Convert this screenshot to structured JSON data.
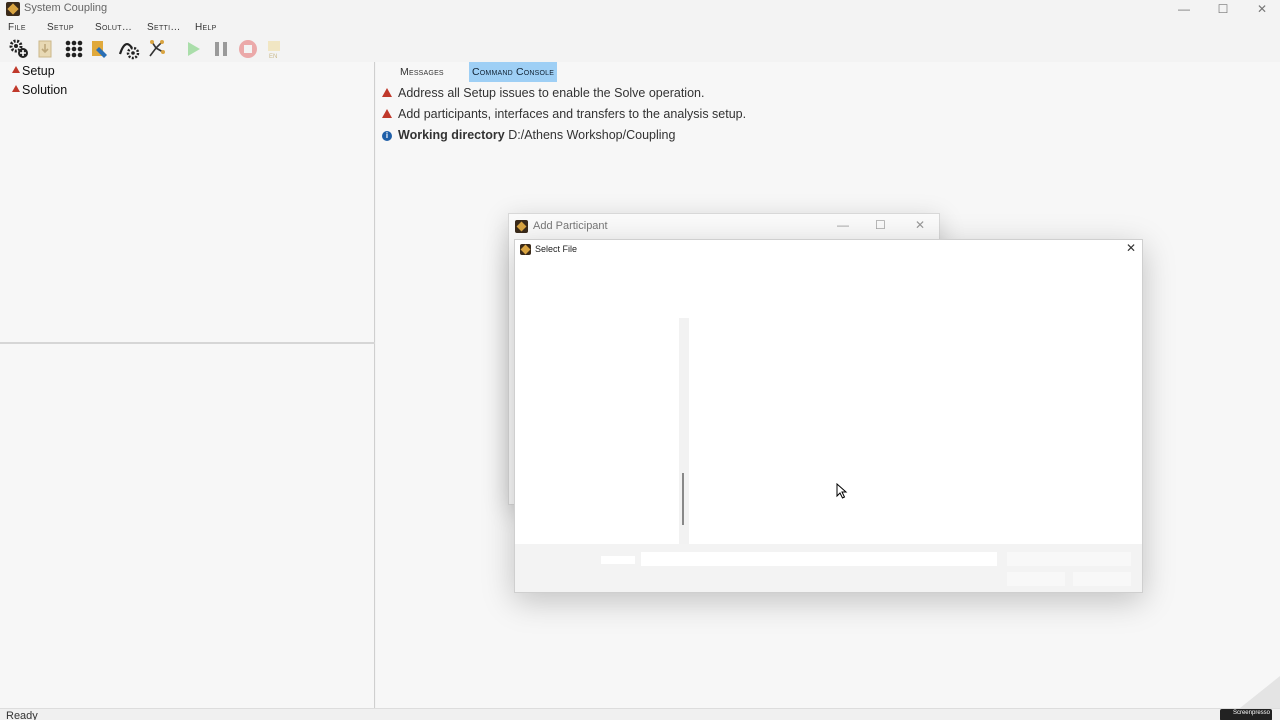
{
  "window": {
    "title": "System Coupling",
    "controls": {
      "minimize": "—",
      "maximize": "☐",
      "close": "✕"
    }
  },
  "menu": [
    {
      "label": "File"
    },
    {
      "label": "Setup"
    },
    {
      "label": "Solut…"
    },
    {
      "label": "Setti…"
    },
    {
      "label": "Help"
    }
  ],
  "toolbar": {
    "icons": [
      "setup-gear-icon",
      "import-icon",
      "dots-grid-icon",
      "file-tag-icon",
      "curve-gear-icon",
      "tree-icon",
      "play-icon",
      "pause-icon",
      "stop-icon",
      "en-icon"
    ],
    "en_label": "EN"
  },
  "tree": {
    "items": [
      {
        "label": "Setup"
      },
      {
        "label": "Solution"
      }
    ]
  },
  "tabs": {
    "messages": "Messages",
    "console": "Command Console"
  },
  "messages": [
    {
      "type": "warning",
      "text": "Address all Setup issues to enable the Solve operation."
    },
    {
      "type": "warning",
      "text": "Add participants, interfaces and transfers to the analysis setup."
    },
    {
      "type": "info",
      "bold": "Working directory",
      "text": "D:/Athens Workshop/Coupling"
    }
  ],
  "add_participant": {
    "title": "Add Participant"
  },
  "select_file": {
    "title": "Select File",
    "close": "✕"
  },
  "status": {
    "text": "Ready",
    "watermark": "Screenpresso"
  },
  "colors": {
    "accent_tab": "#9ecff5",
    "warning": "#c0392b",
    "info": "#1f5fa8",
    "play": "#7ad17a",
    "stop": "#e36b6b"
  }
}
